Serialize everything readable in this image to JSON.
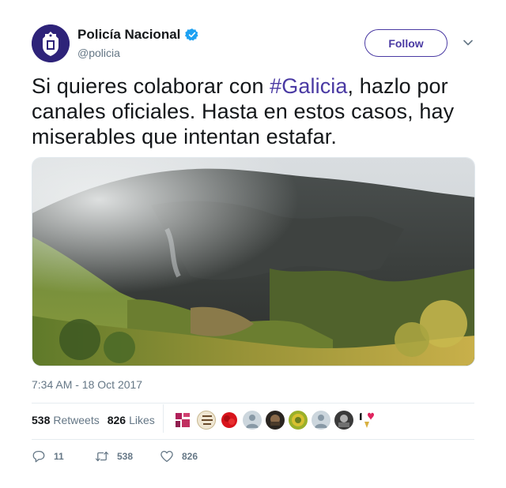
{
  "account": {
    "display_name": "Policía Nacional",
    "handle": "@policia",
    "verified": true
  },
  "header": {
    "follow_label": "Follow"
  },
  "tweet": {
    "text_before": "Si quieres colaborar con ",
    "hashtag": "#Galicia",
    "text_after": ", hazlo por canales oficiales. Hasta en estos casos, hay miserables que intentan estafar.",
    "timestamp": "7:34 AM - 18 Oct 2017"
  },
  "stats": {
    "retweets_count": "538",
    "retweets_label": "Retweets",
    "likes_count": "826",
    "likes_label": "Likes"
  },
  "actions": {
    "replies": "11",
    "retweets": "538",
    "likes": "826"
  },
  "colors": {
    "accent": "#4a3aa3",
    "verified": "#1da1f2",
    "muted": "#657786",
    "avatar_bg": "#2e2379"
  },
  "icons": {
    "verified": "verified-badge-icon",
    "caret": "chevron-down-icon",
    "reply": "reply-icon",
    "retweet": "retweet-icon",
    "like": "heart-icon"
  }
}
